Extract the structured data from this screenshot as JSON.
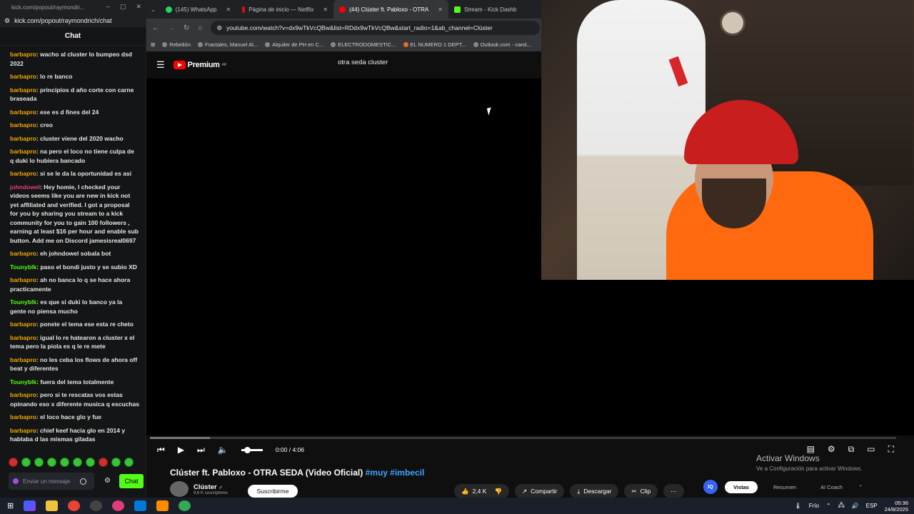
{
  "chat_window": {
    "title_url": "kick.com/popout/raymondri...",
    "address": "kick.com/popout/raymondrich/chat",
    "heading": "Chat",
    "messages": [
      {
        "user": "barbapro",
        "text": "wacho al cluster lo bumpeo dsd 2022",
        "color": "#f2a900"
      },
      {
        "user": "barbapro",
        "text": "lo re banco",
        "color": "#f2a900"
      },
      {
        "user": "barbapro",
        "text": "principios d año corte con carne braseada",
        "color": "#f2a900"
      },
      {
        "user": "barbapro",
        "text": "ese es d fines del 24",
        "color": "#f2a900"
      },
      {
        "user": "barbapro",
        "text": "creo",
        "color": "#f2a900"
      },
      {
        "user": "barbapro",
        "text": "cluster viene del 2020 wacho",
        "color": "#f2a900"
      },
      {
        "user": "barbapro",
        "text": "na pero el loco no tiene culpa de q duki lo hubiera bancado",
        "color": "#f2a900"
      },
      {
        "user": "barbapro",
        "text": "si se le da la oportunidad es asi",
        "color": "#f2a900"
      },
      {
        "user": "johndowel",
        "text": "Hey homie, I checked your videos seems like you are new in kick not yet affiliated and verified. I got a proposal for you by sharing you stream to a kick community for you to gain 100 followers , earning at least $16 per hour and enable sub button. Add me on Discord jamesisreal0697",
        "color": "#e0407a"
      },
      {
        "user": "barbapro",
        "text": "eh johndowel sobala bot",
        "color": "#f2a900"
      },
      {
        "user": "Tounyblk",
        "text": "paso el bondi justo y se subio XD",
        "color": "#53fc18"
      },
      {
        "user": "barbapro",
        "text": "ah no banca lo q se hace ahora practicamente",
        "color": "#f2a900"
      },
      {
        "user": "Tounyblk",
        "text": "es que si duki lo banco ya la gente no piensa mucho",
        "color": "#53fc18"
      },
      {
        "user": "barbapro",
        "text": "ponete el tema ese esta re cheto",
        "color": "#f2a900"
      },
      {
        "user": "barbapro",
        "text": "igual lo re hatearon a cluster x el tema pero la piola es q le re mete",
        "color": "#f2a900"
      },
      {
        "user": "barbapro",
        "text": "no les ceba los flows de ahora off beat y diferentes",
        "color": "#f2a900"
      },
      {
        "user": "Tounyblk",
        "text": "fuera del tema totalmente",
        "color": "#53fc18"
      },
      {
        "user": "barbapro",
        "text": "pero si te rescatas vos estas opinando eso x diferente musica q escuchas",
        "color": "#f2a900"
      },
      {
        "user": "barbapro",
        "text": "el loco hace glo y fue",
        "color": "#f2a900"
      },
      {
        "user": "barbapro",
        "text": "chief keef hacia glo en 2014 y hablaba d las mismas giladas",
        "color": "#f2a900"
      }
    ],
    "input_placeholder": "Enviar un mensaje",
    "send_label": "Chat"
  },
  "browser": {
    "tabs": [
      {
        "label": "(145) WhatsApp",
        "color": "#25d366"
      },
      {
        "label": "Página de inicio — Netflix",
        "color": "#e50914"
      },
      {
        "label": "(44) Clúster ft. Pabloxo - OTRA",
        "color": "#ff0000"
      },
      {
        "label": "Stream - Kick Dashb",
        "color": "#53fc18"
      }
    ],
    "url": "youtube.com/watch?v=dx9wTkVcQBw&list=RDdx9wTkVcQBw&start_radio=1&ab_channel=Clúster",
    "bookmarks": [
      "Rebelión",
      "Fractales, Manuel Al...",
      "Alquiler de PH en C...",
      "ELECTRODOMESTIC...",
      "EL NUMERO 1 DEPT...",
      "Outlook.com - carol..."
    ],
    "yt_logo": "Premium",
    "yt_region": "AR",
    "search_query": "otra seda cluster"
  },
  "player": {
    "time": "0:00 / 4:06",
    "progress_fraction": 0.0
  },
  "watermark": {
    "line1": "Activar Windows",
    "line2": "Ve a Configuración para activar Windows."
  },
  "video": {
    "title": "Clúster ft. Pabloxo - OTRA SEDA (Video Oficial)",
    "hashtags": "#muy #imbecil",
    "channel": "Clúster",
    "subscribers": "9,6 K suscriptores",
    "subscribe_label": "Suscribirme",
    "likes": "2,4 K",
    "share_label": "Compartir",
    "download_label": "Descargar",
    "clip_label": "Clip",
    "ext_tabs": [
      "Vistas",
      "Resumen",
      "AI Coach"
    ]
  },
  "taskbar": {
    "weather": "Frío",
    "lang": "ESP",
    "time": "05:36",
    "date": "24/8/2025"
  }
}
